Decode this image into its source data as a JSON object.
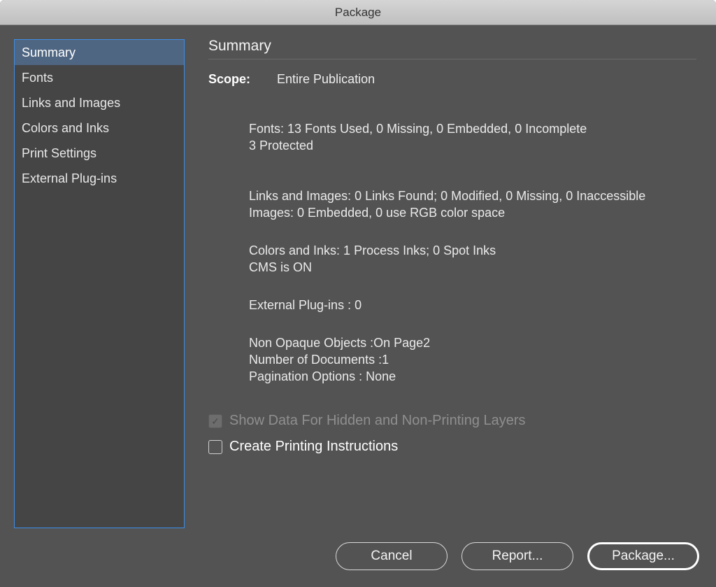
{
  "title": "Package",
  "sidebar": {
    "selectedIndex": 0,
    "items": [
      {
        "label": "Summary"
      },
      {
        "label": "Fonts"
      },
      {
        "label": "Links and Images"
      },
      {
        "label": "Colors and Inks"
      },
      {
        "label": "Print Settings"
      },
      {
        "label": "External Plug-ins"
      }
    ]
  },
  "main": {
    "heading": "Summary",
    "scopeLabel": "Scope:",
    "scopeValue": "Entire Publication",
    "fontsLine1": "Fonts: 13 Fonts Used, 0 Missing, 0 Embedded, 0 Incomplete",
    "fontsLine2": "3 Protected",
    "linksLine1": "Links and Images: 0 Links Found; 0 Modified, 0 Missing, 0 Inaccessible",
    "linksLine2": "Images: 0 Embedded, 0 use RGB color space",
    "colorsLine1": "Colors and Inks: 1 Process Inks; 0 Spot Inks",
    "colorsLine2": "CMS is ON",
    "pluginsLine": "External Plug-ins : 0",
    "opaqueLine": "Non Opaque Objects :On Page2",
    "docsLine": "Number of Documents :1",
    "paginationLine": "Pagination Options : None",
    "checkboxes": {
      "showDataLabel": "Show Data For Hidden and Non-Printing Layers",
      "showDataChecked": true,
      "showDataDisabled": true,
      "createPrintLabel": "Create Printing Instructions",
      "createPrintChecked": false
    }
  },
  "footer": {
    "cancel": "Cancel",
    "report": "Report...",
    "package": "Package..."
  }
}
